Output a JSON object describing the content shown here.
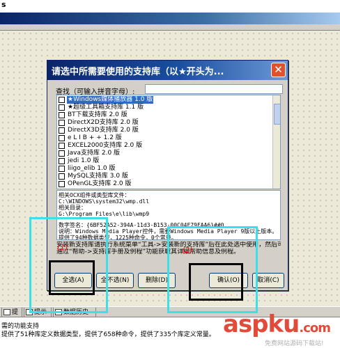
{
  "top_strip_text": "s",
  "dialog": {
    "title": "请选中所需要使用的支持库（以★开头为...",
    "close_glyph": "✕",
    "search_label": "查找（可输入拼音字母）:",
    "search_value": "",
    "libraries": [
      {
        "label": "★Windows媒体播放器 1.0 版",
        "checked": false,
        "selected": true
      },
      {
        "label": "★超级工具箱支持库 1.1 版",
        "checked": false,
        "selected": false
      },
      {
        "label": "BT下载支持库 2.0 版",
        "checked": false,
        "selected": false
      },
      {
        "label": "DirectX2D支持库 2.0 版",
        "checked": false,
        "selected": false
      },
      {
        "label": "DirectX3D支持库 2.0 版",
        "checked": false,
        "selected": false
      },
      {
        "label": "e L I B + + 1.2 版",
        "checked": false,
        "selected": false
      },
      {
        "label": "EXCEL2000支持库 2.0 版",
        "checked": false,
        "selected": false
      },
      {
        "label": "Java支持库 2.0 版",
        "checked": false,
        "selected": false
      },
      {
        "label": "jedi 1.0 版",
        "checked": false,
        "selected": false
      },
      {
        "label": "liigo_elib 1.0 版",
        "checked": false,
        "selected": false
      },
      {
        "label": "MySQL支持库 3.0 版",
        "checked": false,
        "selected": false
      },
      {
        "label": "OPenGL支持库 2.0 版",
        "checked": false,
        "selected": false
      }
    ],
    "info_lines": [
      "相关OCX组件或类型库文件：",
      "C:\\WINDOWS\\system32\\wmp.dll",
      "相关目录：",
      "G:\\Program Files\\e\\lib\\wmp9",
      "",
      "数字签名：{6BF52A52-394A-11d3-B153-00C04F79FAA6}##0",
      "说明：Windows Media Player控件，需要Windows Media Player 9版以上版本。",
      "提供了94种数据类型，1225种命令，0个常量。"
    ],
    "tip_lines": [
      "安装新支持库请执行系统菜单“工具->安装新的支持库”后在此处选中使用，然后可以",
      "通过“帮助->支持库手册及例程”功能获取其详细帮助信息及例程。"
    ],
    "buttons": {
      "select_all": "全选(A)",
      "deselect_all": "全不选(N)",
      "delete": "删除(D)",
      "ok": "确认(O)",
      "cancel": "取消(C)"
    }
  },
  "annotations": {
    "label_1": "(1)",
    "label_2": "(2)"
  },
  "bottom_tabs": [
    {
      "label": "提示1"
    },
    {
      "label": "提示2"
    },
    {
      "label": "数据历史"
    }
  ],
  "output_lines": [
    "需的功能支持",
    "  提供了51种库定义数据类型，提供了658种命令，提供了335个库定义常量。"
  ],
  "watermark": {
    "brand_prefix": "asp",
    "brand_suffix": "ku",
    "domain_suffix": ".com",
    "subtitle": "免费网站源码下载站!"
  },
  "colors": {
    "overlay_cyan": "#3de0e8",
    "overlay_black": "#000000",
    "title_blue": "#0a246a",
    "watermark_red": "#e24a3a"
  }
}
